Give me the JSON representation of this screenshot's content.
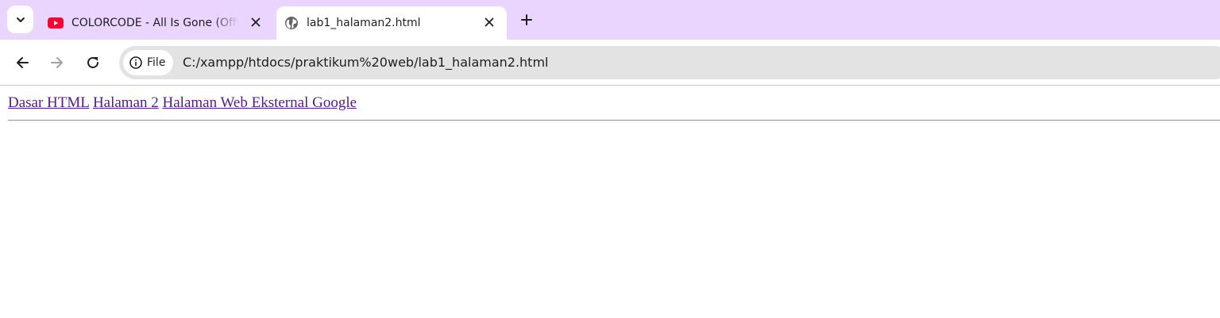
{
  "browser": {
    "tabs": [
      {
        "title": "COLORCODE - All Is Gone (Offic",
        "icon": "youtube-icon",
        "active": false
      },
      {
        "title": "lab1_halaman2.html",
        "icon": "globe-icon",
        "active": true
      }
    ],
    "address_bar": {
      "chip_label": "File",
      "url": "C:/xampp/htdocs/praktikum%20web/lab1_halaman2.html"
    },
    "colors": {
      "tabstrip": "#e9d5fd",
      "omnibox": "#e3e3e3",
      "visited_link": "#551a8b"
    }
  },
  "page": {
    "links": [
      {
        "label": "Dasar HTML"
      },
      {
        "label": "Halaman 2"
      },
      {
        "label": "Halaman Web Eksternal Google"
      }
    ]
  }
}
